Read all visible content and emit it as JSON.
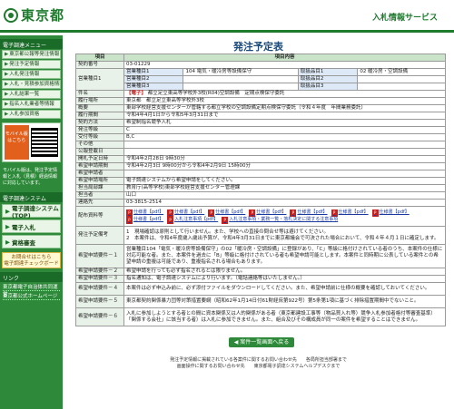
{
  "header": {
    "logo_text": "東京都",
    "service_name": "入札情報サービス"
  },
  "sidebar": {
    "menu_heading": "電子調達メニュー",
    "items": [
      {
        "label": "東京都公報等発注情報"
      },
      {
        "label": "発注予定情報"
      },
      {
        "label": "入札発注情報"
      },
      {
        "label": "入札・見積参加資格情報"
      },
      {
        "label": "入札結果一覧"
      },
      {
        "label": "指名入札業者等情報"
      },
      {
        "label": "入札参加資格"
      }
    ],
    "mobile_badge": "モバイル版はこちら",
    "mobile_note": "モバイル版は、発注予定情報と入札（見積）経過情報に対応しています。",
    "system_heading": "電子調達システム",
    "big_buttons": [
      {
        "label": "電子調達システム(TOP)"
      },
      {
        "label": "電子入札"
      },
      {
        "label": "資格審査"
      }
    ],
    "check_label": "お問合せはこちら",
    "check_sub": "電子調達チェックボード",
    "links_heading": "リンク",
    "links": [
      {
        "label": "東京都電子自治体共同運営"
      },
      {
        "label": "東京都公式ホームページ"
      }
    ]
  },
  "main": {
    "title": "発注予定表",
    "col_item": "項目",
    "col_content": "項目内容",
    "rows": {
      "keiyaku_label": "契約番号",
      "keiyaku_value": "03-01229",
      "eigyo1_label": "営業種目1",
      "eigyo1_sub": "営業種目1",
      "eigyo1_value": "104 電気・暖冷房等設備保守",
      "eigyo1_item": "取扱品目1",
      "eigyo1_item_value": "02 暖冷房・空調設備",
      "eigyo2_label": "営業種目2",
      "eigyo2_sub": "営業種目2",
      "eigyo2_value": "",
      "eigyo2_item": "取扱品目2",
      "eigyo2_item_value": "",
      "eigyo2_sub2": "営業種目3",
      "eigyo2_item2": "取扱品目3",
      "kenmei_label": "件名",
      "kenmei_tag": "【電子】",
      "kenmei_value": "都立足立東高等学校外3校(R04)空調設備　定期点検保守委託",
      "basho_label": "履行場所",
      "basho_value": "東京都　都立足立東高等学校外3校",
      "gaiyo_label": "概要",
      "gaiyo_value": "東部学校経営支援センターが管轄する都立学校の空調設備定期点検保守委託（令和４年度　年間業務委託）",
      "kikan_label": "履行期間",
      "kikan_value": "令和4年4月1日から令和5年3月31日まで",
      "houhou_label": "契約方法",
      "houhou_value": "希望制指名競争入札",
      "hacchu_label": "発注等級",
      "hacchu_value": "C",
      "juju_label": "受付等級",
      "juju_value": "B,C",
      "sonota_label": "その他",
      "sonota_value": "",
      "kohou_label": "公報登載日",
      "kohou_value": "",
      "kaishi_label": "開札予定日時",
      "kaishi_value": "令和4年2月28日 9時30分",
      "kibou_label": "希望申請期間",
      "kibou_value": "令和4年2月3日 9時00分から令和4年2月9日 15時00分",
      "kibou_shimei_label": "希望申請者",
      "kibou_shimei_value": "",
      "kibou_houhou_label": "希望申請場所",
      "kibou_houhou_value": "電子調達システムから希望申請をしてください。",
      "tantou_label": "担当局部課",
      "tantou_value": "教育庁(高等学校)東部学校経営支援センター管理課",
      "tantousha_label": "担当者",
      "tantousha_value": "山口",
      "renraku_label": "連絡先",
      "renraku_value": "03-3815-2514",
      "haifu_label": "配布資料等",
      "docs": [
        "仕様書【pdf】",
        "仕様書【pdf】",
        "仕様書【pdf】",
        "仕様書【pdf】",
        "仕様書【pdf】",
        "仕様書【pdf】",
        "仕様書【pdf】",
        "仕様書【pdf】",
        "入札注意事項【pdf】",
        "入札注意事項・業務一覧・落札決定に関する注意事項"
      ],
      "bikou_label": "発注予定備考",
      "bikou_1": "1　現場確認は原則として行いません。また、学校への直接の問合せ等は避けてください。",
      "bikou_2": "2　本案件は、令和4年度歳入歳出予算が、令和4年3月31日までに東京都議会で可決された場合において、令和４年４月１日に確定します。",
      "j1_label": "希望申請要件－１",
      "j1_value": "営業種目104「電気・暖冷房等設備保守」の02「暖冷房・空調設備」に登録があり、「C」等級に格付けされている者のうち、本案件の仕様に対応可能な者。また、本案件を過去に「B」等級に格付けされている者も希望申請可能とします。本案件と同時期に公表している案件との希望申請の重複は可能であり、重複指名される場合もあります。",
      "j2_label": "希望申請要件－２",
      "j2_value": "希望申請を行っても必ず指名されるとは限りません。",
      "j3_label": "希望申請要件－３",
      "j3_value": "指名通知は、電子調達システムにより行います。（電話連絡等はいたしません。）",
      "j4_label": "希望申請要件－４",
      "j4_value": "本案件は必ず申込み前に、必ず添付ファイルをダウンロードしてください。また、希望申請前に仕様の概要を確認しておいてください。",
      "j5_label": "希望申請要件－５",
      "j5_value": "東京都契約関係暴力団等対策措置要綱（昭和62年1月14日付61財経庶第922号）第5条第1項に基づく排除措置期間中でないこと。",
      "j6_label": "希望申請要件－６",
      "j6_value": "入札に参加しようとする者との間に資本関係又は人的関係がある者（東京都建設工事等（物品買入れ等）競争入札参加者格付等審査基準）「関係する会社」に該当する者）は入札に参加できません。また、組合及びその構成員が同一の案件を希望することはできません。"
    },
    "back_button": "案件一覧画面へ戻る",
    "footer_1": "発注予定情報に掲載されている各案件に関するお問い合わせ先　　各局所担当部署まで",
    "footer_2": "画面操作に関するお問い合わせ先　　東京都電子調達システムヘルプデスクまで"
  }
}
